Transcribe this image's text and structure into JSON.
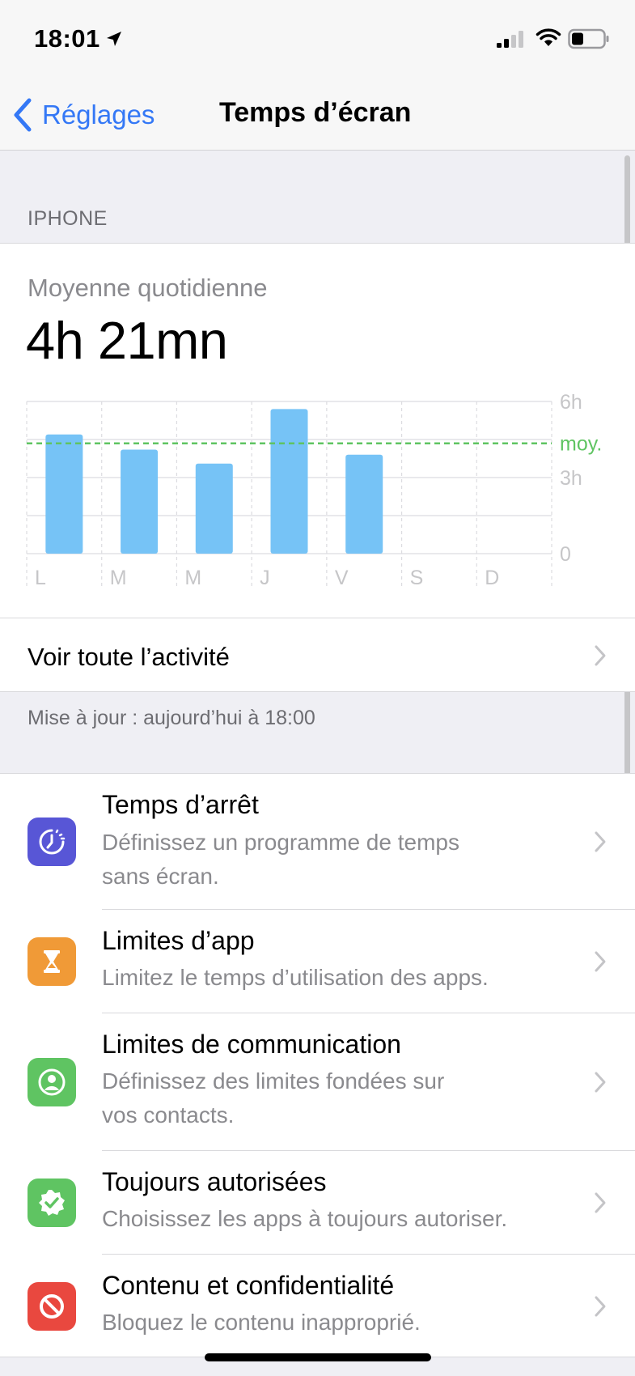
{
  "status_bar": {
    "time": "18:01"
  },
  "nav": {
    "back_label": "Réglages",
    "title": "Temps d’écran"
  },
  "section_header": "IPHONE",
  "summary": {
    "label": "Moyenne quotidienne",
    "value": "4h 21mn"
  },
  "chart_data": {
    "type": "bar",
    "categories": [
      "L",
      "M",
      "M",
      "J",
      "V",
      "S",
      "D"
    ],
    "values": [
      4.7,
      4.1,
      3.55,
      5.7,
      3.9,
      0,
      0
    ],
    "ylim": [
      0,
      6
    ],
    "y_ticks": [
      {
        "label": "6h",
        "value": 6
      },
      {
        "label": "3h",
        "value": 3
      },
      {
        "label": "0",
        "value": 0
      }
    ],
    "average": {
      "label": "moy.",
      "value": 4.35
    },
    "grid": true,
    "colors": {
      "bar": "#76c3f6",
      "average_line": "#5fc462",
      "tick_text": "#c6c6c8"
    }
  },
  "activity_row": {
    "label": "Voir toute l’activité"
  },
  "updated_label": "Mise à jour : aujourd’hui à 18:00",
  "options": [
    {
      "icon": "downtime-icon",
      "color": "#5856d6",
      "title": "Temps d’arrêt",
      "desc_lines": [
        "Définissez un programme de temps",
        "sans écran."
      ]
    },
    {
      "icon": "hourglass-icon",
      "color": "#f09a37",
      "title": "Limites d’app",
      "desc_lines": [
        "Limitez le temps d’utilisation des apps."
      ]
    },
    {
      "icon": "contact-icon",
      "color": "#5fc462",
      "title": "Limites de communication",
      "desc_lines": [
        "Définissez des limites fondées sur",
        "vos contacts."
      ]
    },
    {
      "icon": "checkmark-badge-icon",
      "color": "#5fc462",
      "title": "Toujours autorisées",
      "desc_lines": [
        "Choisissez les apps à toujours autoriser."
      ]
    },
    {
      "icon": "restricted-icon",
      "color": "#e9483f",
      "title": "Contenu et confidentialité",
      "desc_lines": [
        "Bloquez le contenu inapproprié."
      ]
    }
  ]
}
